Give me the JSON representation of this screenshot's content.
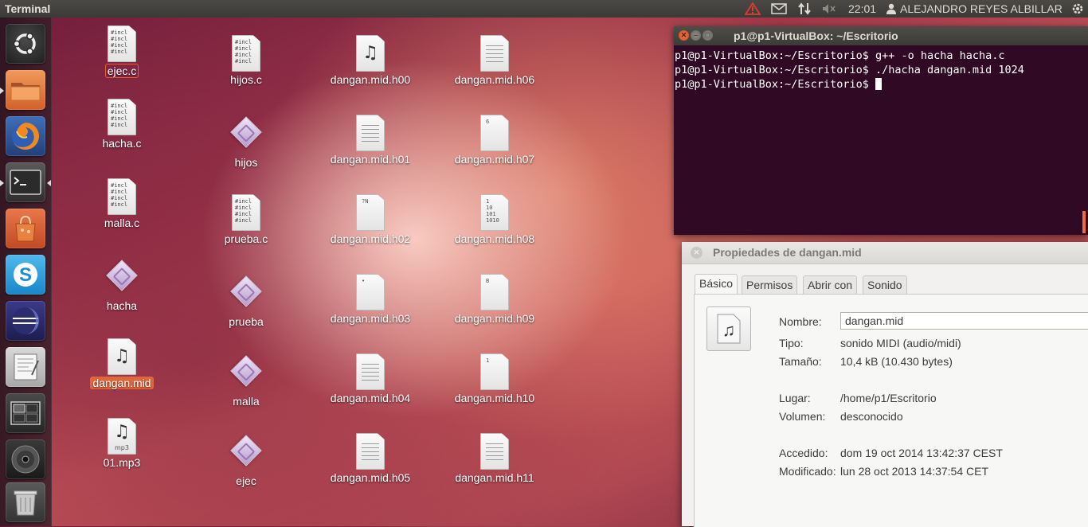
{
  "panel": {
    "app_name": "Terminal",
    "time": "22:01",
    "user": "ALEJANDRO REYES ALBILLAR"
  },
  "launcher": {
    "items": [
      "dash-home",
      "files",
      "firefox",
      "terminal",
      "software-center",
      "skype",
      "eclipse",
      "text-editor",
      "workspace-switcher",
      "disc",
      "trash"
    ]
  },
  "desktop": {
    "col1": [
      {
        "label": "ejec.c",
        "type": "source"
      },
      {
        "label": "hacha.c",
        "type": "source"
      },
      {
        "label": "malla.c",
        "type": "source"
      },
      {
        "label": "hacha",
        "type": "exec"
      },
      {
        "label": "dangan.mid",
        "type": "music"
      },
      {
        "label": "01.mp3",
        "type": "mp3"
      }
    ],
    "col2": [
      {
        "label": "hijos.c",
        "type": "source"
      },
      {
        "label": "hijos",
        "type": "exec"
      },
      {
        "label": "prueba.c",
        "type": "source"
      },
      {
        "label": "prueba",
        "type": "exec"
      },
      {
        "label": "malla",
        "type": "exec"
      },
      {
        "label": "ejec",
        "type": "exec"
      }
    ],
    "col3": [
      {
        "label": "dangan.mid.h00",
        "type": "music"
      },
      {
        "label": "dangan.mid.h01",
        "type": "text"
      },
      {
        "label": "dangan.mid.h02",
        "type": "tiny",
        "glyph": "?N"
      },
      {
        "label": "dangan.mid.h03",
        "type": "tiny",
        "glyph": "•"
      },
      {
        "label": "dangan.mid.h04",
        "type": "text"
      },
      {
        "label": "dangan.mid.h05",
        "type": "text"
      }
    ],
    "col4": [
      {
        "label": "dangan.mid.h06",
        "type": "text"
      },
      {
        "label": "dangan.mid.h07",
        "type": "tiny",
        "glyph": "6"
      },
      {
        "label": "dangan.mid.h08",
        "type": "binary",
        "glyph": "1\n10\n101\n1010"
      },
      {
        "label": "dangan.mid.h09",
        "type": "tiny",
        "glyph": "B"
      },
      {
        "label": "dangan.mid.h10",
        "type": "tiny",
        "glyph": "1"
      },
      {
        "label": "dangan.mid.h11",
        "type": "text"
      }
    ],
    "src_glyph": "#incl\n#incl\n#incl\n#incl",
    "mp3_sub": "mp3"
  },
  "terminal": {
    "title": "p1@p1-VirtualBox: ~/Escritorio",
    "lines": [
      "p1@p1-VirtualBox:~/Escritorio$ g++ -o hacha hacha.c",
      "p1@p1-VirtualBox:~/Escritorio$ ./hacha dangan.mid 1024",
      "p1@p1-VirtualBox:~/Escritorio$ "
    ]
  },
  "properties": {
    "title": "Propiedades de dangan.mid",
    "tabs": [
      "Básico",
      "Permisos",
      "Abrir con",
      "Sonido"
    ],
    "name_label": "Nombre:",
    "name_value": "dangan.mid",
    "type_label": "Tipo:",
    "type_value": "sonido MIDI (audio/midi)",
    "size_label": "Tamaño:",
    "size_value": "10,4 kB (10.430 bytes)",
    "location_label": "Lugar:",
    "location_value": "/home/p1/Escritorio",
    "volume_label": "Volumen:",
    "volume_value": "desconocido",
    "accessed_label": "Accedido:",
    "accessed_value": "dom 19 oct 2014 13:42:37 CEST",
    "modified_label": "Modificado:",
    "modified_value": "lun 28 oct 2013 14:37:54 CET"
  },
  "colors": {
    "accent": "#e0673c",
    "terminal_bg": "#300a24",
    "panel_bg": "#3c3b37"
  }
}
